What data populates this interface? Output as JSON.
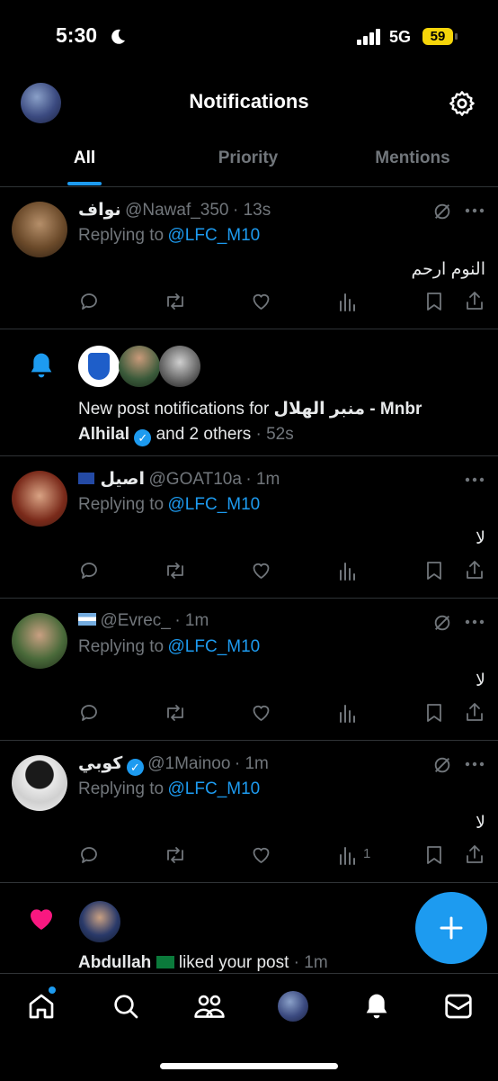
{
  "status_bar": {
    "time": "5:30",
    "network": "5G",
    "battery": "59"
  },
  "header": {
    "title": "Notifications"
  },
  "tabs": [
    {
      "label": "All"
    },
    {
      "label": "Priority"
    },
    {
      "label": "Mentions"
    }
  ],
  "notifications": [
    {
      "type": "reply",
      "name": "نواف",
      "handle": "@Nawaf_350",
      "time": "· 13s",
      "replying_prefix": "Replying to",
      "replying_handle": "@LFC_M10",
      "text": "النوم ارحم"
    },
    {
      "type": "post_alert",
      "prefix": "New post notifications for",
      "bold_name": "منبر الهلال - Mnbr",
      "bold_name2": "Alhilal",
      "suffix": "and 2 others",
      "time": "· 52s"
    },
    {
      "type": "reply",
      "name": "اصيل",
      "handle": "@GOAT10a",
      "time": "· 1m",
      "replying_prefix": "Replying to",
      "replying_handle": "@LFC_M10",
      "text": "لا"
    },
    {
      "type": "reply",
      "name": "",
      "handle": "@Evrec_",
      "time": "· 1m",
      "replying_prefix": "Replying to",
      "replying_handle": "@LFC_M10",
      "text": "لا"
    },
    {
      "type": "reply",
      "name": "كوبي",
      "handle": "@1Mainoo",
      "time": "· 1m",
      "replying_prefix": "Replying to",
      "replying_handle": "@LFC_M10",
      "text": "لا",
      "views": "1"
    },
    {
      "type": "like",
      "name": "Abdullah",
      "action": "liked your post",
      "time": "· 1m"
    }
  ],
  "icons": {
    "settings": "gear-icon",
    "reply": "speech-bubble-icon",
    "repost": "repost-icon",
    "like": "heart-icon",
    "views": "bar-chart-icon",
    "bookmark": "bookmark-icon",
    "share": "share-icon",
    "more": "more-icon",
    "bell": "bell-icon",
    "compose": "plus-icon"
  },
  "colors": {
    "accent": "#1d9bf0",
    "like": "#f91880",
    "muted": "#71767b",
    "background": "#000000"
  }
}
